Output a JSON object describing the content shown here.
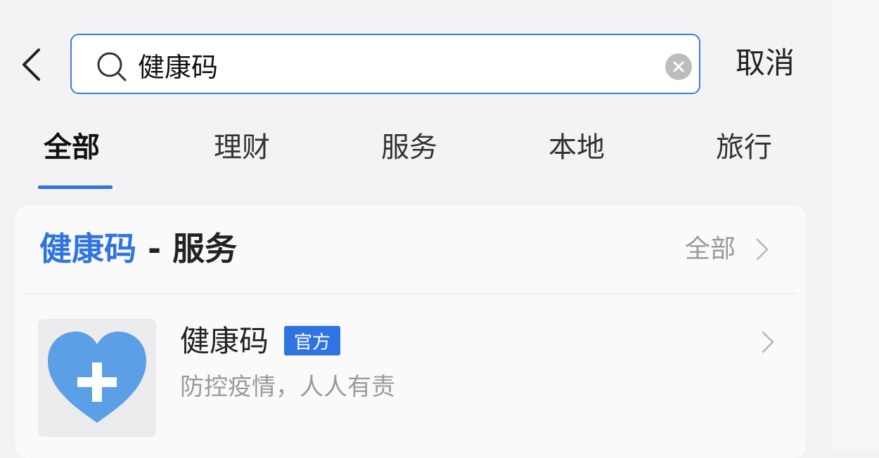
{
  "header": {
    "search_value": "健康码",
    "cancel_label": "取消"
  },
  "tabs": [
    {
      "label": "全部",
      "active": true
    },
    {
      "label": "理财",
      "active": false
    },
    {
      "label": "服务",
      "active": false
    },
    {
      "label": "本地",
      "active": false
    },
    {
      "label": "旅行",
      "active": false
    }
  ],
  "section": {
    "title_keyword": "健康码",
    "title_rest": " - 服务",
    "see_all_label": "全部"
  },
  "result": {
    "name": "健康码",
    "badge": "官方",
    "description": "防控疫情，人人有责"
  },
  "icons": {
    "back": "chevron-left-icon",
    "search": "search-icon",
    "clear": "clear-icon",
    "see_all": "chevron-right-icon",
    "app": "heart-plus-icon"
  },
  "colors": {
    "accent": "#2f74e0",
    "app_icon_blue": "#5b9fe6",
    "muted_text": "#9a9a9a"
  }
}
